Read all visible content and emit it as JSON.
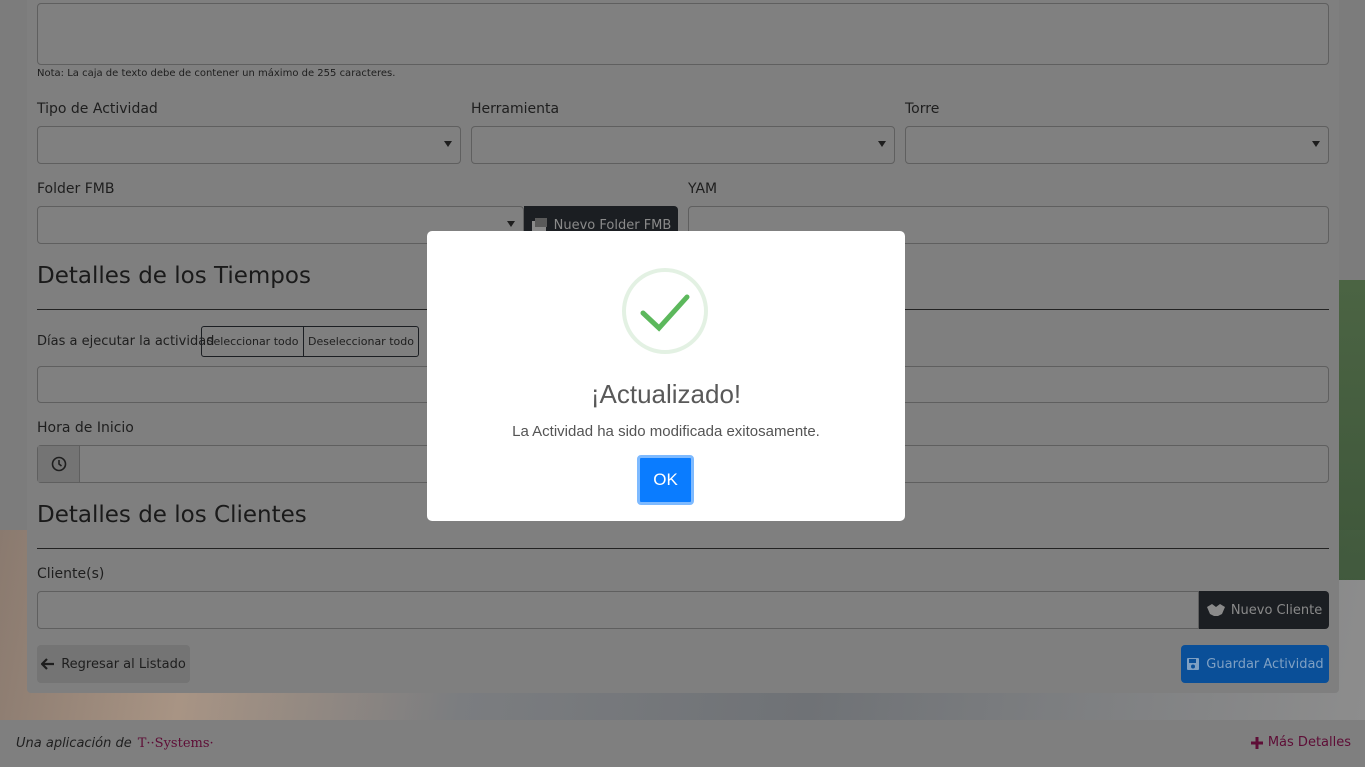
{
  "form": {
    "note": "Nota: La caja de texto debe de contener un máximo de 255 caracteres.",
    "tipo_actividad_label": "Tipo de Actividad",
    "herramienta_label": "Herramienta",
    "torre_label": "Torre",
    "folder_fmb_label": "Folder FMB",
    "nuevo_folder_label": "Nuevo Folder FMB",
    "yam_label": "YAM",
    "tiempos_heading": "Detalles de los Tiempos",
    "dias_label": "Días a ejecutar la actividad",
    "seleccionar_todo": "Seleccionar todo",
    "deseleccionar_todo": "Deseleccionar todo",
    "hora_inicio_label": "Hora de Inicio",
    "clientes_heading": "Detalles de los Clientes",
    "clientes_label": "Cliente(s)",
    "nuevo_cliente_label": "Nuevo Cliente",
    "regresar_label": "Regresar al Listado",
    "guardar_label": "Guardar Actividad"
  },
  "footer": {
    "prefix": "Una aplicación de",
    "brand": "T··Systems·",
    "mas_detalles": "Más Detalles"
  },
  "modal": {
    "title": "¡Actualizado!",
    "message": "La Actividad ha sido modificada exitosamente.",
    "ok_label": "OK"
  },
  "colors": {
    "success": "#5cb85c",
    "ok_button": "#0a7cff",
    "brand": "#e20074"
  }
}
